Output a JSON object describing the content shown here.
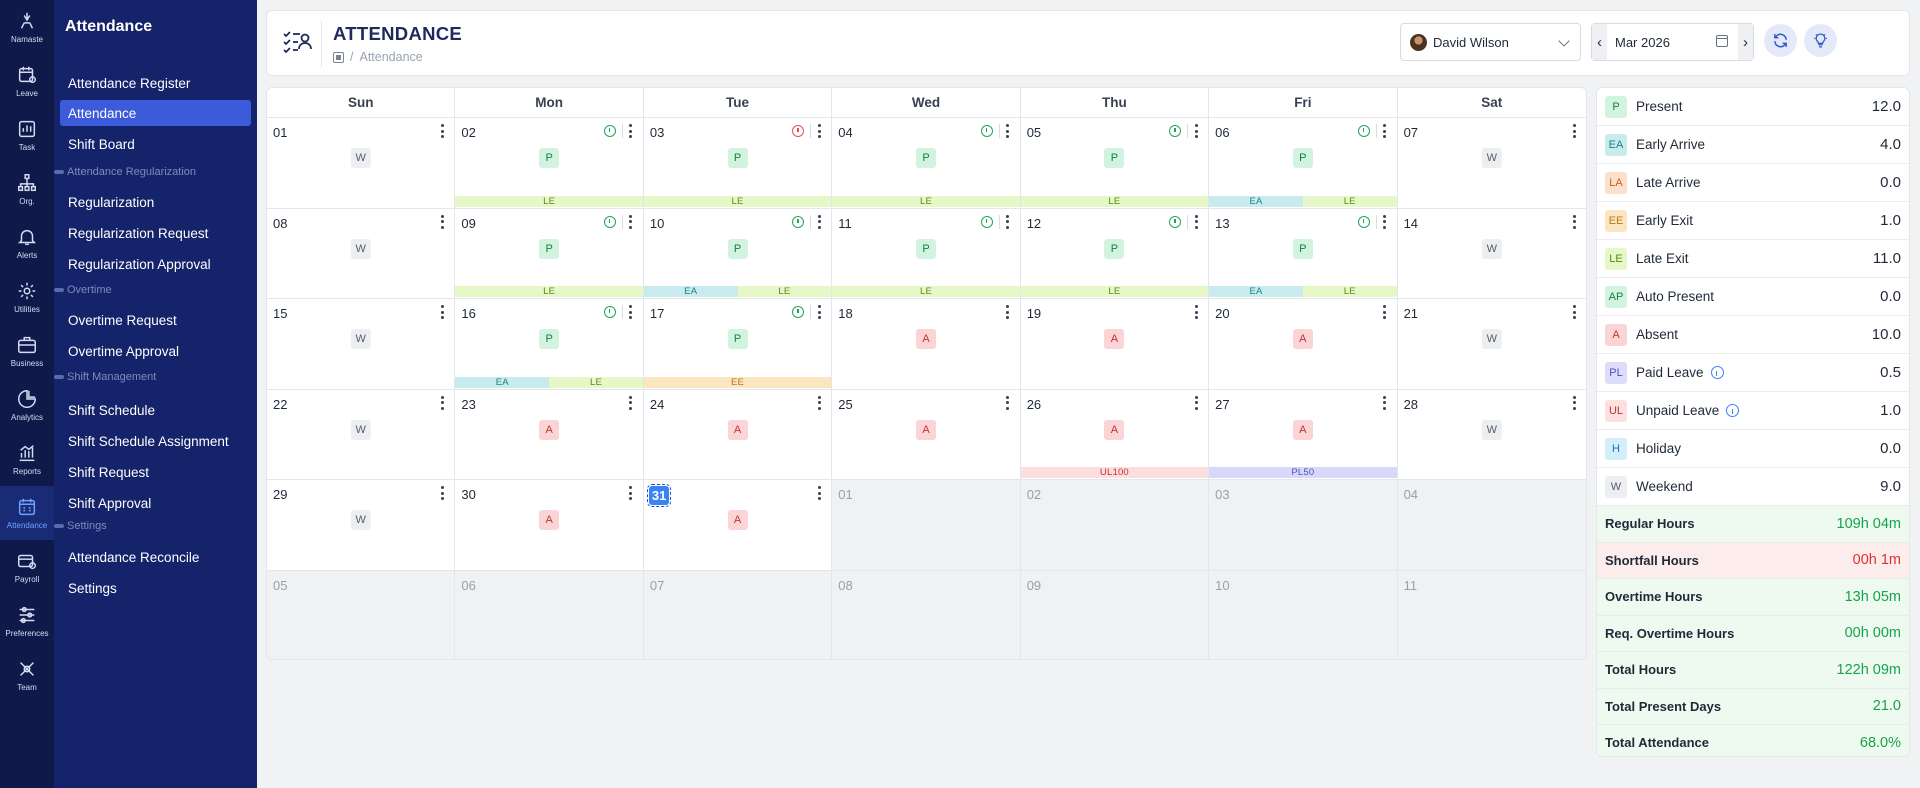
{
  "rail": [
    {
      "label": "Namaste",
      "icon": "namaste-icon"
    },
    {
      "label": "Leave",
      "icon": "leave-icon"
    },
    {
      "label": "Task",
      "icon": "task-icon"
    },
    {
      "label": "Org.",
      "icon": "org-icon"
    },
    {
      "label": "Alerts",
      "icon": "alerts-icon"
    },
    {
      "label": "Utilities",
      "icon": "utilities-icon"
    },
    {
      "label": "Business",
      "icon": "business-icon"
    },
    {
      "label": "Analytics",
      "icon": "analytics-icon"
    },
    {
      "label": "Reports",
      "icon": "reports-icon"
    },
    {
      "label": "Attendance",
      "icon": "attendance-icon",
      "active": true
    },
    {
      "label": "Payroll",
      "icon": "payroll-icon"
    },
    {
      "label": "Preferences",
      "icon": "preferences-icon"
    },
    {
      "label": "Team",
      "icon": "team-icon"
    }
  ],
  "sidebar": {
    "title": "Attendance",
    "items": [
      {
        "label": "Attendance Register",
        "type": "item"
      },
      {
        "label": "Attendance",
        "type": "item",
        "active": true
      },
      {
        "label": "Shift Board",
        "type": "item"
      },
      {
        "label": "Attendance Regularization",
        "type": "section"
      },
      {
        "label": "Regularization",
        "type": "item"
      },
      {
        "label": "Regularization Request",
        "type": "item"
      },
      {
        "label": "Regularization Approval",
        "type": "item"
      },
      {
        "label": "Overtime",
        "type": "section"
      },
      {
        "label": "Overtime Request",
        "type": "item"
      },
      {
        "label": "Overtime Approval",
        "type": "item"
      },
      {
        "label": "Shift Management",
        "type": "section"
      },
      {
        "label": "Shift Schedule",
        "type": "item"
      },
      {
        "label": "Shift Schedule Assignment",
        "type": "item"
      },
      {
        "label": "Shift Request",
        "type": "item"
      },
      {
        "label": "Shift Approval",
        "type": "item"
      },
      {
        "label": "Settings",
        "type": "section"
      },
      {
        "label": "Attendance Reconcile",
        "type": "item"
      },
      {
        "label": "Settings",
        "type": "item"
      }
    ]
  },
  "header": {
    "title": "ATTENDANCE",
    "breadcrumb_sep": "/",
    "breadcrumb_current": "Attendance",
    "user": "David Wilson",
    "month": "Mar 2026",
    "prev": "‹",
    "next": "›"
  },
  "calendar": {
    "weekdays": [
      "Sun",
      "Mon",
      "Tue",
      "Wed",
      "Thu",
      "Fri",
      "Sat"
    ],
    "days": [
      {
        "d": "01",
        "badge": "W"
      },
      {
        "d": "02",
        "badge": "P",
        "info": "green",
        "strip": [
          "LE"
        ]
      },
      {
        "d": "03",
        "badge": "P",
        "info": "red",
        "strip": [
          "LE"
        ]
      },
      {
        "d": "04",
        "badge": "P",
        "info": "green",
        "strip": [
          "LE"
        ]
      },
      {
        "d": "05",
        "badge": "P",
        "info": "green",
        "strip": [
          "LE"
        ]
      },
      {
        "d": "06",
        "badge": "P",
        "info": "green",
        "strip": [
          "EA",
          "LE"
        ]
      },
      {
        "d": "07",
        "badge": "W"
      },
      {
        "d": "08",
        "badge": "W"
      },
      {
        "d": "09",
        "badge": "P",
        "info": "green",
        "strip": [
          "LE"
        ]
      },
      {
        "d": "10",
        "badge": "P",
        "info": "green",
        "strip": [
          "EA",
          "LE"
        ]
      },
      {
        "d": "11",
        "badge": "P",
        "info": "green",
        "strip": [
          "LE"
        ]
      },
      {
        "d": "12",
        "badge": "P",
        "info": "green",
        "strip": [
          "LE"
        ]
      },
      {
        "d": "13",
        "badge": "P",
        "info": "green",
        "strip": [
          "EA",
          "LE"
        ]
      },
      {
        "d": "14",
        "badge": "W"
      },
      {
        "d": "15",
        "badge": "W"
      },
      {
        "d": "16",
        "badge": "P",
        "info": "green",
        "strip": [
          "EA",
          "LE"
        ]
      },
      {
        "d": "17",
        "badge": "P",
        "info": "green",
        "strip": [
          "EE"
        ]
      },
      {
        "d": "18",
        "badge": "A"
      },
      {
        "d": "19",
        "badge": "A"
      },
      {
        "d": "20",
        "badge": "A"
      },
      {
        "d": "21",
        "badge": "W"
      },
      {
        "d": "22",
        "badge": "W"
      },
      {
        "d": "23",
        "badge": "A"
      },
      {
        "d": "24",
        "badge": "A"
      },
      {
        "d": "25",
        "badge": "A"
      },
      {
        "d": "26",
        "badge": "A",
        "strip": [
          "UL100"
        ]
      },
      {
        "d": "27",
        "badge": "A",
        "strip": [
          "PL50"
        ]
      },
      {
        "d": "28",
        "badge": "W"
      },
      {
        "d": "29",
        "badge": "W"
      },
      {
        "d": "30",
        "badge": "A"
      },
      {
        "d": "31",
        "badge": "A",
        "today": true
      },
      {
        "d": "01",
        "other": true
      },
      {
        "d": "02",
        "other": true
      },
      {
        "d": "03",
        "other": true
      },
      {
        "d": "04",
        "other": true
      },
      {
        "d": "05",
        "other": true
      },
      {
        "d": "06",
        "other": true
      },
      {
        "d": "07",
        "other": true
      },
      {
        "d": "08",
        "other": true
      },
      {
        "d": "09",
        "other": true
      },
      {
        "d": "10",
        "other": true
      },
      {
        "d": "11",
        "other": true
      }
    ]
  },
  "summary": {
    "counts": [
      {
        "code": "P",
        "label": "Present",
        "value": "12.0",
        "bg": "#d2f3df",
        "fg": "#15803d"
      },
      {
        "code": "EA",
        "label": "Early Arrive",
        "value": "4.0",
        "bg": "#c8ecee",
        "fg": "#1f7f86"
      },
      {
        "code": "LA",
        "label": "Late Arrive",
        "value": "0.0",
        "bg": "#fde0cc",
        "fg": "#c2611f"
      },
      {
        "code": "EE",
        "label": "Early Exit",
        "value": "1.0",
        "bg": "#fbe6c0",
        "fg": "#b7791f"
      },
      {
        "code": "LE",
        "label": "Late Exit",
        "value": "11.0",
        "bg": "#e6f8c8",
        "fg": "#5a8a19"
      },
      {
        "code": "AP",
        "label": "Auto Present",
        "value": "0.0",
        "bg": "#d2f3df",
        "fg": "#15803d"
      },
      {
        "code": "A",
        "label": "Absent",
        "value": "10.0",
        "bg": "#fbd5d5",
        "fg": "#c53030"
      },
      {
        "code": "PL",
        "label": "Paid Leave",
        "value": "0.5",
        "bg": "#dcdcfb",
        "fg": "#4c51bf",
        "info": true
      },
      {
        "code": "UL",
        "label": "Unpaid Leave",
        "value": "1.0",
        "bg": "#fde0e0",
        "fg": "#c53030",
        "info": true
      },
      {
        "code": "H",
        "label": "Holiday",
        "value": "0.0",
        "bg": "#d3eefa",
        "fg": "#1c7aa8"
      },
      {
        "code": "W",
        "label": "Weekend",
        "value": "9.0",
        "bg": "#eceef1",
        "fg": "#555d69"
      }
    ],
    "hours": [
      {
        "label": "Regular Hours",
        "value": "109h 04m",
        "tone": "green"
      },
      {
        "label": "Shortfall Hours",
        "value": "00h 1m",
        "tone": "red"
      },
      {
        "label": "Overtime Hours",
        "value": "13h 05m",
        "tone": "green"
      },
      {
        "label": "Req. Overtime Hours",
        "value": "00h 00m",
        "tone": "green"
      },
      {
        "label": "Total Hours",
        "value": "122h 09m",
        "tone": "green"
      },
      {
        "label": "Total Present Days",
        "value": "21.0",
        "tone": "green"
      },
      {
        "label": "Total Attendance",
        "value": "68.0%",
        "tone": "green"
      }
    ]
  }
}
